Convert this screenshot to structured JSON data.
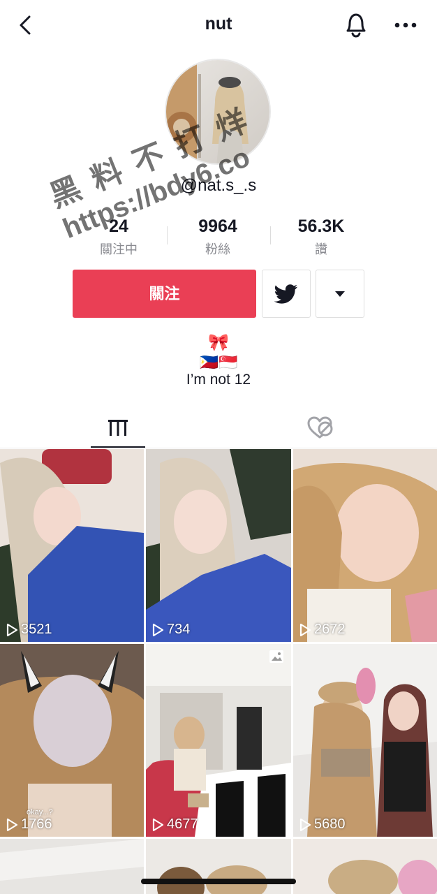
{
  "nav": {
    "title": "nut"
  },
  "profile": {
    "handle": "@nat.s_.s",
    "stats": [
      {
        "value": "24",
        "label": "關注中"
      },
      {
        "value": "9964",
        "label": "粉絲"
      },
      {
        "value": "56.3K",
        "label": "讚"
      }
    ],
    "follow_label": "關注",
    "bio_ribbon": "🎀",
    "bio_flags": "🇵🇭🇸🇬",
    "bio_text": "I’m not 12"
  },
  "videos": [
    {
      "views": "3521"
    },
    {
      "views": "734"
    },
    {
      "views": "2672"
    },
    {
      "views": "1766",
      "caption": "okay...?"
    },
    {
      "views": "4677"
    },
    {
      "views": "5680"
    }
  ],
  "watermark": {
    "line1": "黑料不打烊",
    "line2": "https://bdy6.co"
  },
  "colors": {
    "accent": "#ea3f55",
    "text": "#161823",
    "muted": "#8a8b91"
  }
}
